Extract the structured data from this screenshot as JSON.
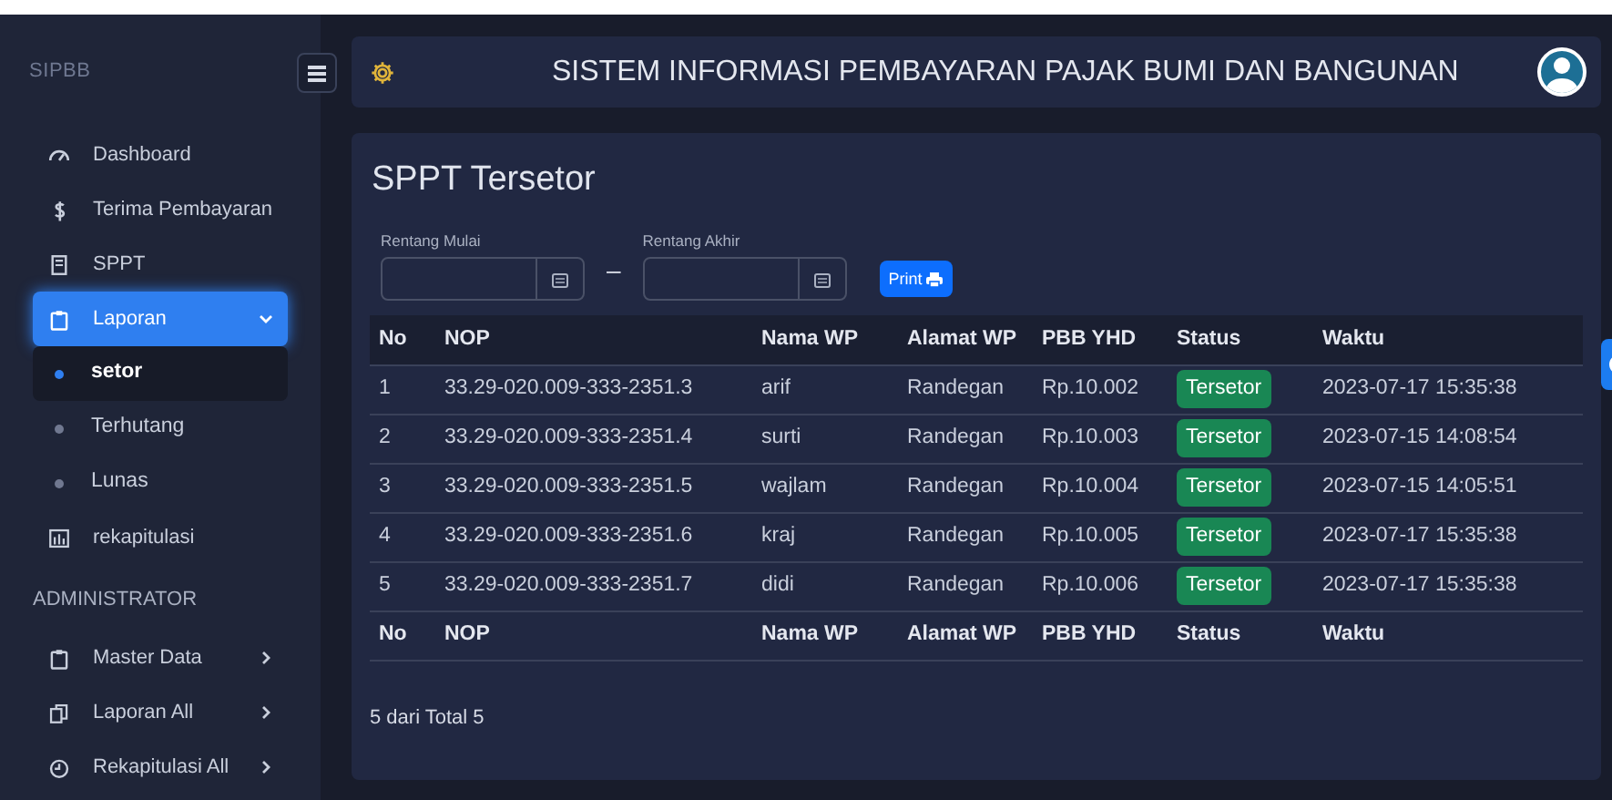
{
  "brand": "SIPBB",
  "sidebar": {
    "items": [
      {
        "label": "Dashboard",
        "kind": "gauge",
        "selected": false
      },
      {
        "label": "Terima Pembayaran",
        "kind": "dollar",
        "selected": false
      },
      {
        "label": "SPPT",
        "kind": "doc",
        "selected": false
      },
      {
        "label": "Laporan",
        "kind": "clipboard",
        "selected": true,
        "expanded": true,
        "children": [
          {
            "label": "setor",
            "selected": true
          },
          {
            "label": "Terhutang",
            "selected": false
          },
          {
            "label": "Lunas",
            "selected": false
          }
        ]
      },
      {
        "label": "rekapitulasi",
        "kind": "chart",
        "selected": false
      }
    ],
    "section": "ADMINISTRATOR",
    "admin_items": [
      {
        "label": "Master Data",
        "kind": "clipboard",
        "expanded": false
      },
      {
        "label": "Laporan All",
        "kind": "copy",
        "expanded": false
      },
      {
        "label": "Rekapitulasi All",
        "kind": "clock",
        "expanded": false
      }
    ]
  },
  "header": {
    "title": "SISTEM INFORMASI PEMBAYARAN PAJAK BUMI DAN BANGUNAN"
  },
  "page": {
    "title": "SPPT Tersetor",
    "filters": [
      {
        "label": "Rentang Mulai"
      },
      {
        "label": "Rentang Akhir"
      }
    ],
    "separator": "–",
    "print_button": "Print",
    "table": {
      "columns": [
        "No",
        "NOP",
        "Nama WP",
        "Alamat WP",
        "PBB YHD",
        "Status",
        "Waktu"
      ],
      "rows": [
        [
          "1",
          "33.29-020.009-333-2351.3",
          "arif",
          "Randegan",
          "Rp.10.002",
          "Tersetor",
          "2023-07-17 15:35:38"
        ],
        [
          "2",
          "33.29-020.009-333-2351.4",
          "surti",
          "Randegan",
          "Rp.10.003",
          "Tersetor",
          "2023-07-15 14:08:54"
        ],
        [
          "3",
          "33.29-020.009-333-2351.5",
          "wajlam",
          "Randegan",
          "Rp.10.004",
          "Tersetor",
          "2023-07-15 14:05:51"
        ],
        [
          "4",
          "33.29-020.009-333-2351.6",
          "kraj",
          "Randegan",
          "Rp.10.005",
          "Tersetor",
          "2023-07-17 15:35:38"
        ],
        [
          "5",
          "33.29-020.009-333-2351.7",
          "didi",
          "Randegan",
          "Rp.10.006",
          "Tersetor",
          "2023-07-17 15:35:38"
        ]
      ],
      "footer_columns": [
        "No",
        "NOP",
        "Nama WP",
        "Alamat WP",
        "PBB YHD",
        "Status",
        "Waktu"
      ]
    },
    "summary": "5 dari Total 5"
  }
}
